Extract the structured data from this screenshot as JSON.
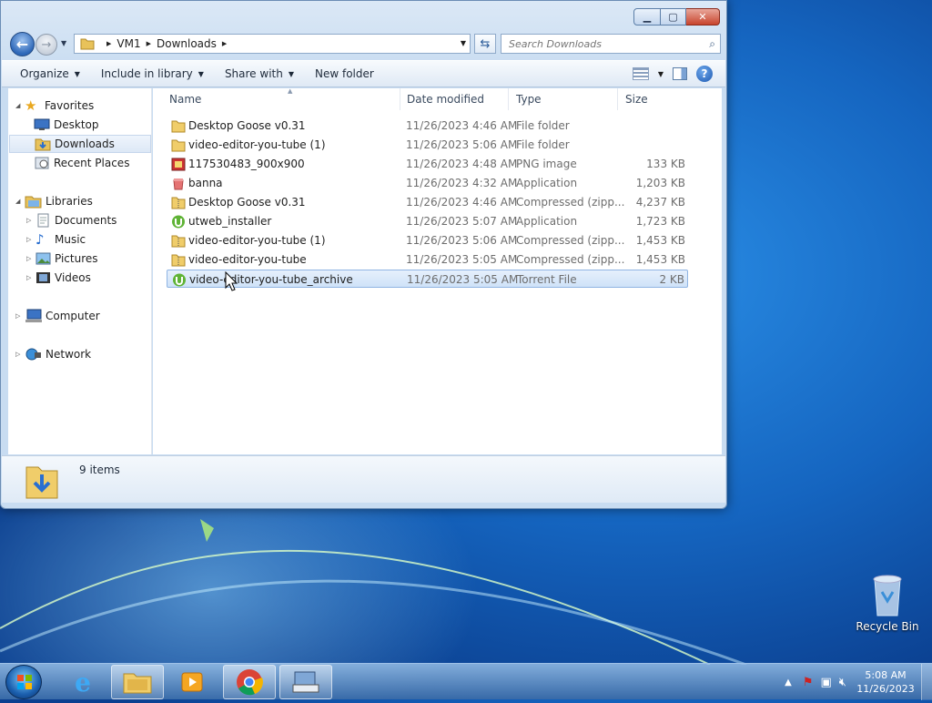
{
  "window": {
    "address": [
      "VM1",
      "Downloads"
    ],
    "search_placeholder": "Search Downloads"
  },
  "commands": {
    "organize": "Organize",
    "include": "Include in library",
    "share": "Share with",
    "new_folder": "New folder"
  },
  "nav": {
    "favorites": "Favorites",
    "desktop": "Desktop",
    "downloads": "Downloads",
    "recent": "Recent Places",
    "libraries": "Libraries",
    "documents": "Documents",
    "music": "Music",
    "pictures": "Pictures",
    "videos": "Videos",
    "computer": "Computer",
    "network": "Network"
  },
  "columns": {
    "name": "Name",
    "date": "Date modified",
    "type": "Type",
    "size": "Size"
  },
  "files": [
    {
      "name": "Desktop Goose v0.31",
      "date": "11/26/2023 4:46 AM",
      "type": "File folder",
      "size": "",
      "icon": "folder-icon"
    },
    {
      "name": "video-editor-you-tube (1)",
      "date": "11/26/2023 5:06 AM",
      "type": "File folder",
      "size": "",
      "icon": "folder-icon"
    },
    {
      "name": "117530483_900x900",
      "date": "11/26/2023 4:48 AM",
      "type": "PNG image",
      "size": "133 KB",
      "icon": "image-icon"
    },
    {
      "name": "banna",
      "date": "11/26/2023 4:32 AM",
      "type": "Application",
      "size": "1,203 KB",
      "icon": "app-icon"
    },
    {
      "name": "Desktop Goose v0.31",
      "date": "11/26/2023 4:46 AM",
      "type": "Compressed (zipp...",
      "size": "4,237 KB",
      "icon": "zip-icon"
    },
    {
      "name": "utweb_installer",
      "date": "11/26/2023 5:07 AM",
      "type": "Application",
      "size": "1,723 KB",
      "icon": "utorrent-icon"
    },
    {
      "name": "video-editor-you-tube (1)",
      "date": "11/26/2023 5:06 AM",
      "type": "Compressed (zipp...",
      "size": "1,453 KB",
      "icon": "zip-icon"
    },
    {
      "name": "video-editor-you-tube",
      "date": "11/26/2023 5:05 AM",
      "type": "Compressed (zipp...",
      "size": "1,453 KB",
      "icon": "zip-icon"
    },
    {
      "name": "video-editor-you-tube_archive",
      "date": "11/26/2023 5:05 AM",
      "type": "Torrent File",
      "size": "2 KB",
      "icon": "torrent-icon",
      "selected": true
    }
  ],
  "details": {
    "count": "9 items"
  },
  "desktop": {
    "recycle_bin": "Recycle Bin"
  },
  "taskbar": {
    "time": "5:08 AM",
    "date": "11/26/2023"
  },
  "colors": {
    "selection": "#cfe2f8",
    "taskbar": "#3c6eaa",
    "desktop": "#1565c0"
  }
}
